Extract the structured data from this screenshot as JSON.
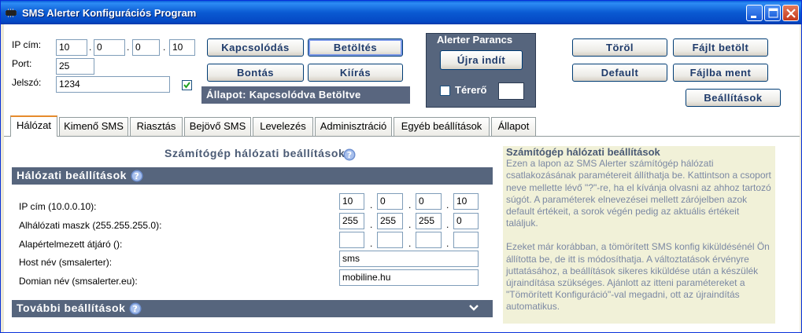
{
  "window": {
    "title": "SMS Alerter Konfigurációs Program"
  },
  "connection": {
    "ip_label": "IP cím:",
    "ip": [
      "10",
      "0",
      "0",
      "10"
    ],
    "port_label": "Port:",
    "port": "25",
    "password_label": "Jelszó:",
    "password": "1234",
    "show_password_checked": true
  },
  "buttons": {
    "connect": "Kapcsolódás",
    "load": "Betöltés",
    "disconnect": "Bontás",
    "write": "Kiírás",
    "delete": "Töröl",
    "load_file": "Fájlt betölt",
    "default": "Default",
    "save_file": "Fájlba ment",
    "settings": "Beállítások"
  },
  "status": {
    "text": "Állapot:  Kapcsolódva  Betöltve"
  },
  "alerter": {
    "title": "Alerter Parancs",
    "restart": "Újra indít",
    "signal_label": "Térerő",
    "signal_checked": false
  },
  "tabs": [
    {
      "label": "Hálózat",
      "active": true
    },
    {
      "label": "Kimenő SMS",
      "active": false
    },
    {
      "label": "Riasztás",
      "active": false
    },
    {
      "label": "Bejövő SMS",
      "active": false
    },
    {
      "label": "Levelezés",
      "active": false
    },
    {
      "label": "Adminisztráció",
      "active": false
    },
    {
      "label": "Egyéb beállítások",
      "active": false
    },
    {
      "label": "Állapot",
      "active": false
    }
  ],
  "network": {
    "page_title": "Számítógép hálózati beállítások",
    "group_title": "Hálózati beállítások",
    "ip_label": "IP cím (10.0.0.10):",
    "ip": [
      "10",
      "0",
      "0",
      "10"
    ],
    "mask_label": "Alhálózati maszk (255.255.255.0):",
    "mask": [
      "255",
      "255",
      "255",
      "0"
    ],
    "gateway_label": "Alapértelmezett átjáró ():",
    "gateway": [
      "",
      "",
      "",
      ""
    ],
    "host_label": "Host név (smsalerter):",
    "host": "sms",
    "domain_label": "Domian név (smsalerter.eu):",
    "domain": "mobiline.hu",
    "more_group_title": "További beállítások"
  },
  "info": {
    "title": "Számítógép hálózati beállítások",
    "p1": "Ezen a lapon az SMS Alerter számítógép hálózati csatlakozásának paramétereit állíthatja be. Kattintson a csoport neve mellette lévő \"?\"-re, ha el kívánja olvasni az ahhoz tartozó súgót. A paraméterek elnevezései mellett zárójelben azok default értékeit, a sorok végén pedig az aktuális értékeit találjuk.",
    "p2": "Ezeket már korábban, a tömörített SMS konfig kiküldésénél Ön állította be, de itt is módosíthatja. A változtatások érvényre juttatásához, a beállítások sikeres kiküldése után a készülék újraindítása szükséges. Ajánlott az itteni paramétereket a \"Tömörített Konfiguráció\"-val megadni, ott az újraindítás automatikus."
  },
  "colors": {
    "title_bar": "#0a5ad2",
    "panel_dark": "#56657d",
    "info_bg": "#f1f1d8",
    "info_text": "#7b88a3"
  }
}
